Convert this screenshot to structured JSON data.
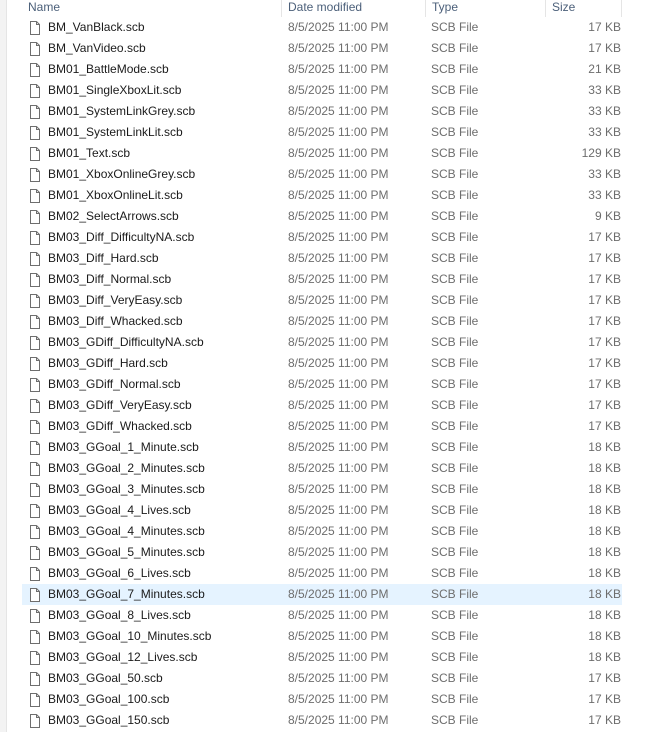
{
  "columns": {
    "name": "Name",
    "date": "Date modified",
    "type": "Type",
    "size": "Size"
  },
  "icon": "generic-file-icon",
  "selected_index": 27,
  "files": [
    {
      "name": "BM_VanBlack.scb",
      "date": "8/5/2025 11:00 PM",
      "type": "SCB File",
      "size": "17 KB"
    },
    {
      "name": "BM_VanVideo.scb",
      "date": "8/5/2025 11:00 PM",
      "type": "SCB File",
      "size": "17 KB"
    },
    {
      "name": "BM01_BattleMode.scb",
      "date": "8/5/2025 11:00 PM",
      "type": "SCB File",
      "size": "21 KB"
    },
    {
      "name": "BM01_SingleXboxLit.scb",
      "date": "8/5/2025 11:00 PM",
      "type": "SCB File",
      "size": "33 KB"
    },
    {
      "name": "BM01_SystemLinkGrey.scb",
      "date": "8/5/2025 11:00 PM",
      "type": "SCB File",
      "size": "33 KB"
    },
    {
      "name": "BM01_SystemLinkLit.scb",
      "date": "8/5/2025 11:00 PM",
      "type": "SCB File",
      "size": "33 KB"
    },
    {
      "name": "BM01_Text.scb",
      "date": "8/5/2025 11:00 PM",
      "type": "SCB File",
      "size": "129 KB"
    },
    {
      "name": "BM01_XboxOnlineGrey.scb",
      "date": "8/5/2025 11:00 PM",
      "type": "SCB File",
      "size": "33 KB"
    },
    {
      "name": "BM01_XboxOnlineLit.scb",
      "date": "8/5/2025 11:00 PM",
      "type": "SCB File",
      "size": "33 KB"
    },
    {
      "name": "BM02_SelectArrows.scb",
      "date": "8/5/2025 11:00 PM",
      "type": "SCB File",
      "size": "9 KB"
    },
    {
      "name": "BM03_Diff_DifficultyNA.scb",
      "date": "8/5/2025 11:00 PM",
      "type": "SCB File",
      "size": "17 KB"
    },
    {
      "name": "BM03_Diff_Hard.scb",
      "date": "8/5/2025 11:00 PM",
      "type": "SCB File",
      "size": "17 KB"
    },
    {
      "name": "BM03_Diff_Normal.scb",
      "date": "8/5/2025 11:00 PM",
      "type": "SCB File",
      "size": "17 KB"
    },
    {
      "name": "BM03_Diff_VeryEasy.scb",
      "date": "8/5/2025 11:00 PM",
      "type": "SCB File",
      "size": "17 KB"
    },
    {
      "name": "BM03_Diff_Whacked.scb",
      "date": "8/5/2025 11:00 PM",
      "type": "SCB File",
      "size": "17 KB"
    },
    {
      "name": "BM03_GDiff_DifficultyNA.scb",
      "date": "8/5/2025 11:00 PM",
      "type": "SCB File",
      "size": "17 KB"
    },
    {
      "name": "BM03_GDiff_Hard.scb",
      "date": "8/5/2025 11:00 PM",
      "type": "SCB File",
      "size": "17 KB"
    },
    {
      "name": "BM03_GDiff_Normal.scb",
      "date": "8/5/2025 11:00 PM",
      "type": "SCB File",
      "size": "17 KB"
    },
    {
      "name": "BM03_GDiff_VeryEasy.scb",
      "date": "8/5/2025 11:00 PM",
      "type": "SCB File",
      "size": "17 KB"
    },
    {
      "name": "BM03_GDiff_Whacked.scb",
      "date": "8/5/2025 11:00 PM",
      "type": "SCB File",
      "size": "17 KB"
    },
    {
      "name": "BM03_GGoal_1_Minute.scb",
      "date": "8/5/2025 11:00 PM",
      "type": "SCB File",
      "size": "18 KB"
    },
    {
      "name": "BM03_GGoal_2_Minutes.scb",
      "date": "8/5/2025 11:00 PM",
      "type": "SCB File",
      "size": "18 KB"
    },
    {
      "name": "BM03_GGoal_3_Minutes.scb",
      "date": "8/5/2025 11:00 PM",
      "type": "SCB File",
      "size": "18 KB"
    },
    {
      "name": "BM03_GGoal_4_Lives.scb",
      "date": "8/5/2025 11:00 PM",
      "type": "SCB File",
      "size": "18 KB"
    },
    {
      "name": "BM03_GGoal_4_Minutes.scb",
      "date": "8/5/2025 11:00 PM",
      "type": "SCB File",
      "size": "18 KB"
    },
    {
      "name": "BM03_GGoal_5_Minutes.scb",
      "date": "8/5/2025 11:00 PM",
      "type": "SCB File",
      "size": "18 KB"
    },
    {
      "name": "BM03_GGoal_6_Lives.scb",
      "date": "8/5/2025 11:00 PM",
      "type": "SCB File",
      "size": "18 KB"
    },
    {
      "name": "BM03_GGoal_7_Minutes.scb",
      "date": "8/5/2025 11:00 PM",
      "type": "SCB File",
      "size": "18 KB"
    },
    {
      "name": "BM03_GGoal_8_Lives.scb",
      "date": "8/5/2025 11:00 PM",
      "type": "SCB File",
      "size": "18 KB"
    },
    {
      "name": "BM03_GGoal_10_Minutes.scb",
      "date": "8/5/2025 11:00 PM",
      "type": "SCB File",
      "size": "18 KB"
    },
    {
      "name": "BM03_GGoal_12_Lives.scb",
      "date": "8/5/2025 11:00 PM",
      "type": "SCB File",
      "size": "18 KB"
    },
    {
      "name": "BM03_GGoal_50.scb",
      "date": "8/5/2025 11:00 PM",
      "type": "SCB File",
      "size": "17 KB"
    },
    {
      "name": "BM03_GGoal_100.scb",
      "date": "8/5/2025 11:00 PM",
      "type": "SCB File",
      "size": "17 KB"
    },
    {
      "name": "BM03_GGoal_150.scb",
      "date": "8/5/2025 11:00 PM",
      "type": "SCB File",
      "size": "17 KB"
    }
  ]
}
